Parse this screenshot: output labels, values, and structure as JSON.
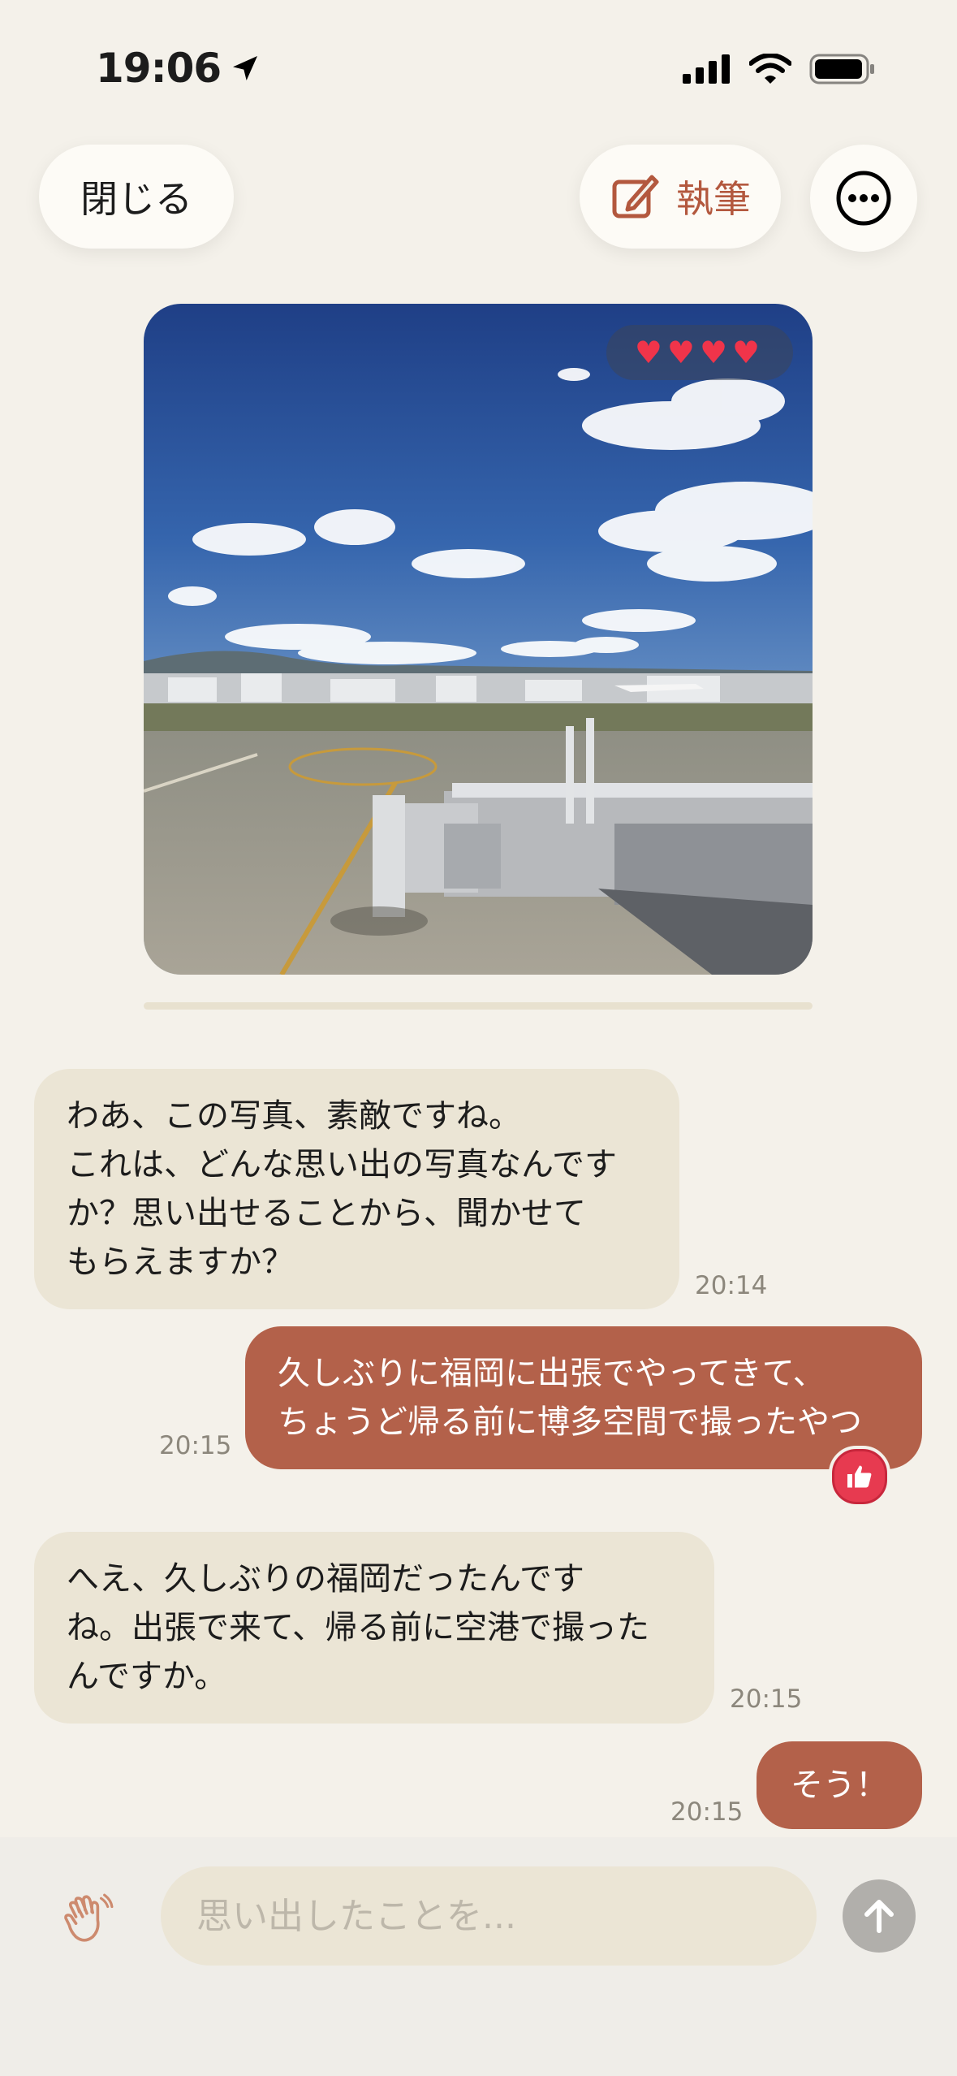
{
  "status_bar": {
    "time": "19:06"
  },
  "header": {
    "close_label": "閉じる",
    "write_label": "執筆"
  },
  "photo": {
    "hearts": "♥♥♥♥",
    "rating": 4
  },
  "messages": [
    {
      "sender": "ai",
      "lines": [
        "わあ、この写真、素敵ですね。",
        "これは、どんな思い出の写真なんです",
        "か？思い出せることから、聞かせて",
        "もらえますか？"
      ],
      "time": "20:14"
    },
    {
      "sender": "me",
      "lines": [
        "久しぶりに福岡に出張でやってきて、",
        "ちょうど帰る前に博多空間で撮ったやつ"
      ],
      "time": "20:15",
      "reaction": "thumbs-up"
    },
    {
      "sender": "ai",
      "lines": [
        "へえ、久しぶりの福岡だったんです",
        "ね。出張で来て、帰る前に空港で撮った",
        "んですか。"
      ],
      "time": "20:15"
    },
    {
      "sender": "me",
      "lines": [
        "そう！"
      ],
      "time": "20:15"
    }
  ],
  "input": {
    "placeholder": "思い出したことを..."
  },
  "colors": {
    "accent": "#b3614a",
    "ai_bubble": "#ebe5d5",
    "background": "#f4f1ea",
    "heart": "#f0344a"
  }
}
